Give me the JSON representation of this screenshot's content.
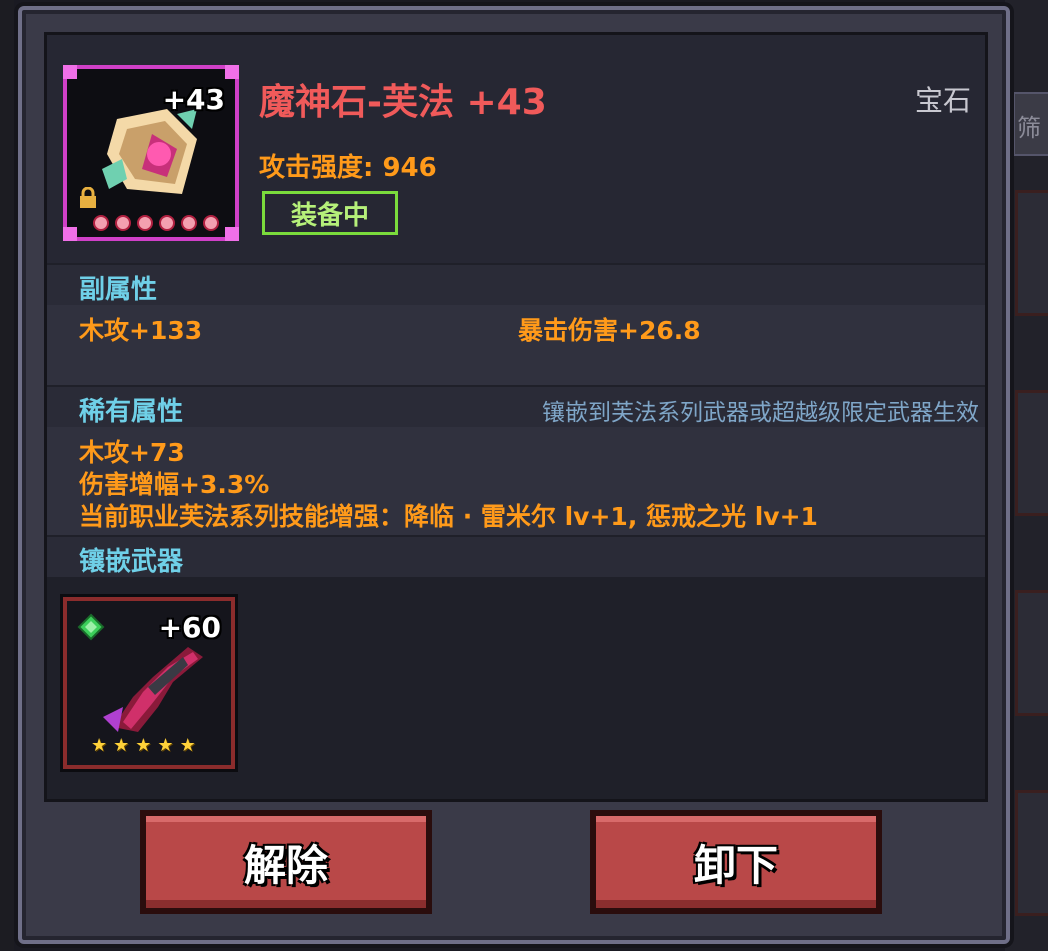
{
  "item": {
    "name": "魔神石-芙法 +43",
    "type": "宝石",
    "level_badge": "+43",
    "attack": "攻击强度: 946",
    "status_badge": "装备中",
    "border_color": "#d040c8"
  },
  "sub_attributes": {
    "label": "副属性",
    "stats": [
      "木攻+133",
      "暴击伤害+26.8"
    ]
  },
  "rare_attributes": {
    "label": "稀有属性",
    "note": "镶嵌到芙法系列武器或超越级限定武器生效",
    "stats": [
      "木攻+73",
      "伤害增幅+3.3%",
      "当前职业芙法系列技能增强：降临 · 雷米尔 lv+1, 惩戒之光 lv+1"
    ]
  },
  "inlay_weapon": {
    "label": "镶嵌武器",
    "level_badge": "+60",
    "stars": 5
  },
  "buttons": {
    "release": "解除",
    "unequip": "卸下"
  },
  "background": {
    "tab_label": "筛"
  }
}
